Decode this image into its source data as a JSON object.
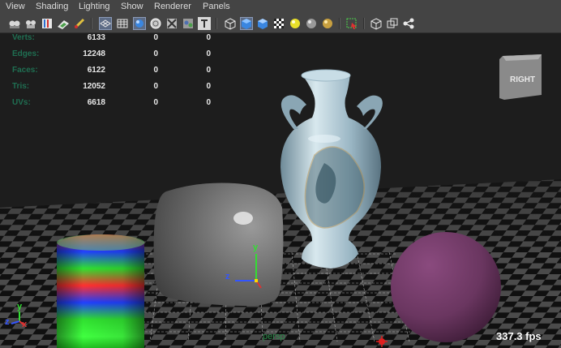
{
  "menubar": {
    "items": [
      "View",
      "Shading",
      "Lighting",
      "Show",
      "Renderer",
      "Panels"
    ]
  },
  "toolbar": {
    "icons": [
      "select-camera-icon",
      "camera-attributes-icon",
      "bookmarks-icon",
      "image-plane-icon",
      "grease-pencil-icon",
      "grid-toggle-icon",
      "wireframe-icon",
      "smooth-shade-icon",
      "wireframe-on-shaded-icon",
      "xray-icon",
      "default-material-icon",
      "textured-icon",
      "use-lights-icon",
      "shadows-icon",
      "ambient-occlusion-icon",
      "isolate-select-icon",
      "xray-joints-icon",
      "xray-active-icon",
      "resolution-gate-icon",
      "film-gate-icon",
      "node-editor-icon"
    ]
  },
  "hud": {
    "stats": [
      {
        "label": "Verts:",
        "values": [
          "6133",
          "0",
          "0"
        ]
      },
      {
        "label": "Edges:",
        "values": [
          "12248",
          "0",
          "0"
        ]
      },
      {
        "label": "Faces:",
        "values": [
          "6122",
          "0",
          "0"
        ]
      },
      {
        "label": "Tris:",
        "values": [
          "12052",
          "0",
          "0"
        ]
      },
      {
        "label": "UVs:",
        "values": [
          "6618",
          "0",
          "0"
        ]
      }
    ],
    "fps": "337.3 fps",
    "camera": "persp"
  },
  "viewcube": {
    "label": "RIGHT"
  },
  "axes": {
    "x": "x",
    "y": "y",
    "z": "z"
  },
  "colors": {
    "menubar_bg": "#444444",
    "viewport_bg": "#1d1d1d",
    "hud_label": "#1f6f52",
    "sphere": "#6a3660",
    "manipulator_y": "#33dd33",
    "manipulator_z": "#3355ff",
    "manipulator_x": "#dd3333"
  }
}
